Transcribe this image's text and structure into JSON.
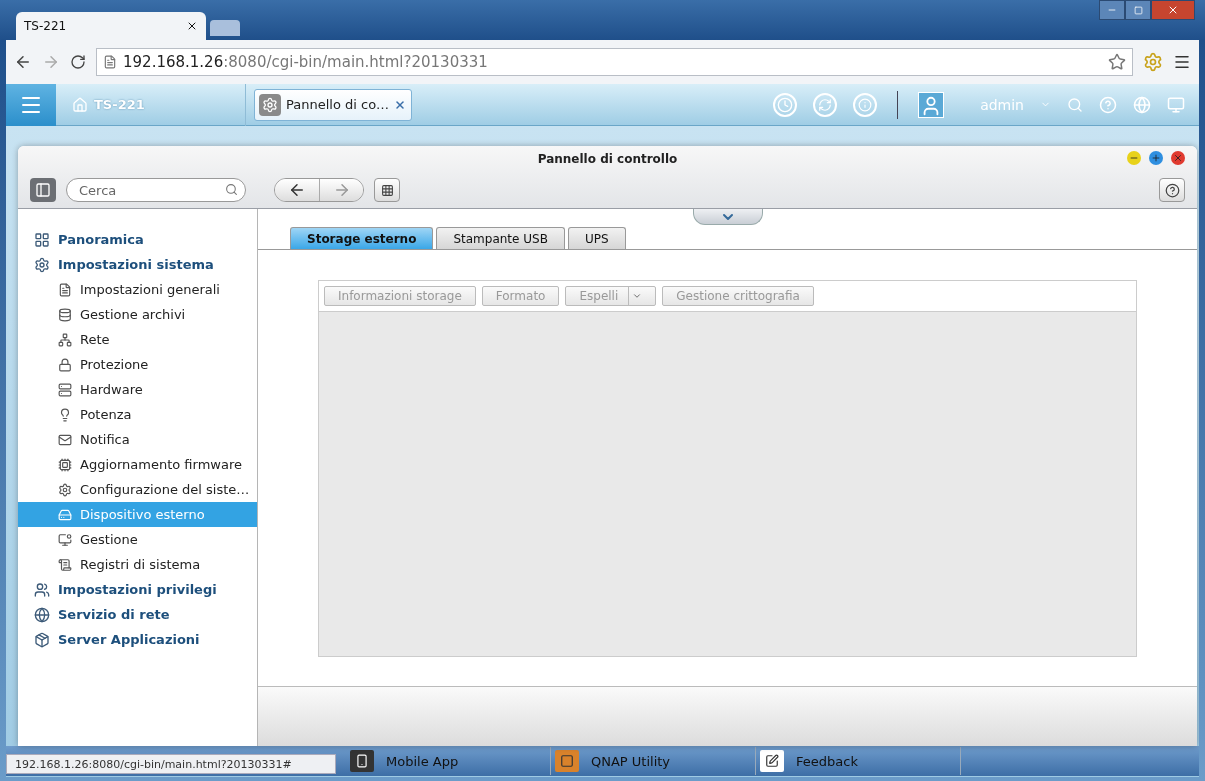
{
  "browser": {
    "tab_title": "TS-221",
    "url_host": "192.168.1.26",
    "url_rest": ":8080/cgi-bin/main.html?20130331"
  },
  "topbar": {
    "home_label": "TS-221",
    "task_label": "Pannello di co…",
    "user": "admin"
  },
  "window": {
    "title": "Pannello di controllo",
    "search": {
      "placeholder": "Cerca"
    }
  },
  "sidebar": {
    "items": [
      {
        "label": "Panoramica",
        "selected": false
      },
      {
        "label": "Impostazioni sistema",
        "selected": false,
        "children": [
          {
            "label": "Impostazioni generali",
            "selected": false
          },
          {
            "label": "Gestione archivi",
            "selected": false
          },
          {
            "label": "Rete",
            "selected": false
          },
          {
            "label": "Protezione",
            "selected": false
          },
          {
            "label": "Hardware",
            "selected": false
          },
          {
            "label": "Potenza",
            "selected": false
          },
          {
            "label": "Notifica",
            "selected": false
          },
          {
            "label": "Aggiornamento firmware",
            "selected": false
          },
          {
            "label": "Configurazione del siste…",
            "selected": false
          },
          {
            "label": "Dispositivo esterno",
            "selected": true
          },
          {
            "label": "Gestione",
            "selected": false
          },
          {
            "label": "Registri di sistema",
            "selected": false
          }
        ]
      },
      {
        "label": "Impostazioni privilegi",
        "selected": false
      },
      {
        "label": "Servizio di rete",
        "selected": false
      },
      {
        "label": "Server Applicazioni",
        "selected": false
      }
    ]
  },
  "tabs": [
    {
      "label": "Storage esterno",
      "selected": true
    },
    {
      "label": "Stampante USB",
      "selected": false
    },
    {
      "label": "UPS",
      "selected": false
    }
  ],
  "toolbar": {
    "buttons": [
      {
        "label": "Informazioni storage",
        "kind": "button",
        "disabled": true
      },
      {
        "label": "Formato",
        "kind": "button",
        "disabled": true
      },
      {
        "label": "Espelli",
        "kind": "split",
        "disabled": true
      },
      {
        "label": "Gestione crittografia",
        "kind": "button",
        "disabled": true
      }
    ]
  },
  "desktop_shortcuts": [
    {
      "label": "Mobile App"
    },
    {
      "label": "QNAP Utility"
    },
    {
      "label": "Feedback"
    }
  ],
  "status_bar": "192.168.1.26:8080/cgi-bin/main.html?20130331#"
}
